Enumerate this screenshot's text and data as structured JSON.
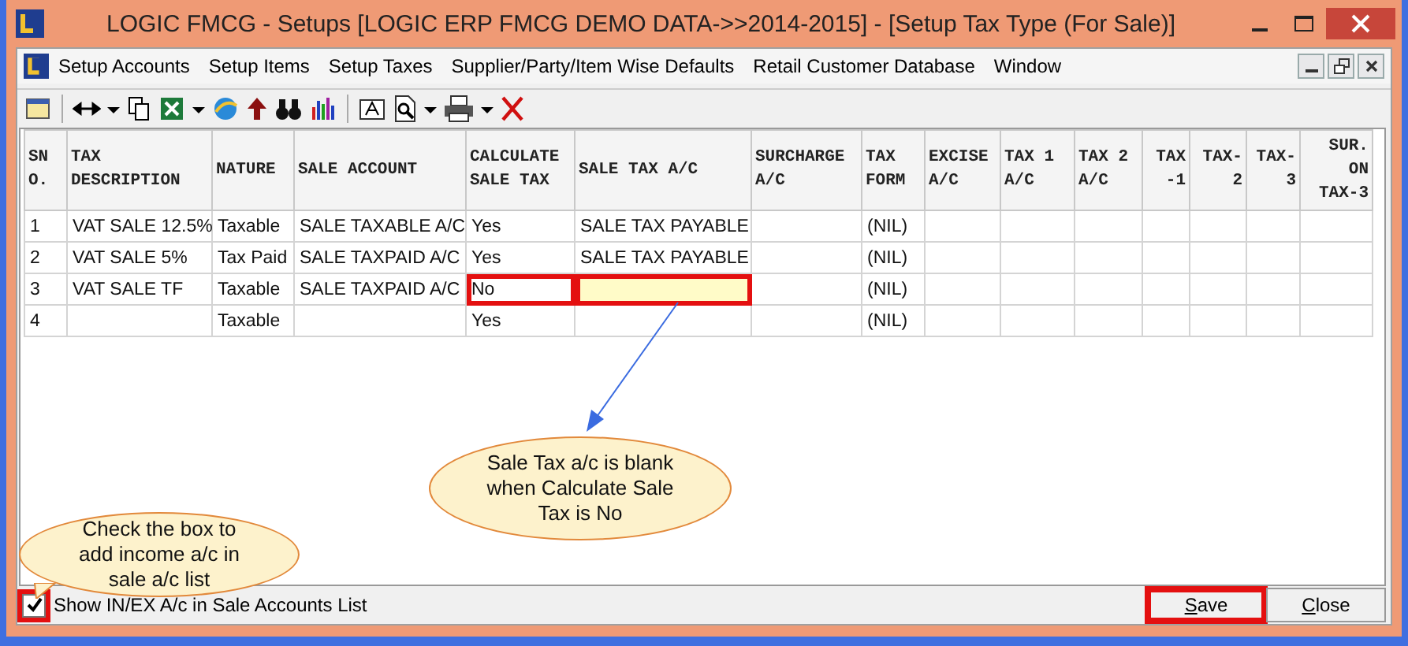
{
  "window": {
    "title": "LOGIC FMCG - Setups  [LOGIC ERP FMCG DEMO DATA->>2014-2015] - [Setup Tax Type (For Sale)]"
  },
  "menu": [
    "Setup Accounts",
    "Setup Items",
    "Setup Taxes",
    "Supplier/Party/Item Wise Defaults",
    "Retail Customer Database",
    "Window"
  ],
  "table": {
    "columns": [
      "SN O.",
      "TAX DESCRIPTION",
      "NATURE",
      "SALE ACCOUNT",
      "CALCULATE SALE TAX",
      "SALE TAX A/C",
      "SURCHARGE A/C",
      "TAX FORM",
      "EXCISE A/C",
      "TAX 1 A/C",
      "TAX 2 A/C",
      "TAX -1",
      "TAX- 2",
      "TAX- 3",
      "SUR. ON TAX-3"
    ],
    "rows": [
      {
        "cells": [
          {
            "text": "1",
            "marked": false,
            "focused": false
          },
          {
            "text": "VAT SALE 12.5%",
            "marked": false,
            "focused": false
          },
          {
            "text": "Taxable",
            "marked": false,
            "focused": false
          },
          {
            "text": "SALE TAXABLE A/C",
            "marked": false,
            "focused": false
          },
          {
            "text": "Yes",
            "marked": false,
            "focused": false
          },
          {
            "text": "SALE TAX PAYABLE",
            "marked": false,
            "focused": false
          },
          {
            "marked": false,
            "focused": false
          },
          {
            "text": "(NIL)",
            "marked": false,
            "focused": false
          },
          {
            "marked": false,
            "focused": false
          },
          {
            "marked": false,
            "focused": false
          },
          {
            "marked": false,
            "focused": false
          },
          {
            "marked": false,
            "focused": false
          },
          {
            "marked": false,
            "focused": false
          },
          {
            "marked": false,
            "focused": false
          },
          {
            "marked": false,
            "focused": false
          }
        ]
      },
      {
        "cells": [
          {
            "text": "2",
            "marked": false,
            "focused": false
          },
          {
            "text": "VAT SALE 5%",
            "marked": false,
            "focused": false
          },
          {
            "text": "Tax Paid",
            "marked": false,
            "focused": false
          },
          {
            "text": "SALE TAXPAID A/C",
            "marked": false,
            "focused": false
          },
          {
            "text": "Yes",
            "marked": false,
            "focused": false
          },
          {
            "text": "SALE TAX PAYABLE",
            "marked": false,
            "focused": false
          },
          {
            "marked": false,
            "focused": false
          },
          {
            "text": "(NIL)",
            "marked": false,
            "focused": false
          },
          {
            "marked": false,
            "focused": false
          },
          {
            "marked": false,
            "focused": false
          },
          {
            "marked": false,
            "focused": false
          },
          {
            "marked": false,
            "focused": false
          },
          {
            "marked": false,
            "focused": false
          },
          {
            "marked": false,
            "focused": false
          },
          {
            "marked": false,
            "focused": false
          }
        ]
      },
      {
        "cells": [
          {
            "text": "3",
            "marked": false,
            "focused": false
          },
          {
            "text": "VAT SALE TF",
            "marked": false,
            "focused": false
          },
          {
            "text": "Taxable",
            "marked": false,
            "focused": false
          },
          {
            "text": "SALE TAXPAID A/C",
            "marked": false,
            "focused": false
          },
          {
            "text": "No",
            "marked": true,
            "focused": false
          },
          {
            "marked": true,
            "focused": true
          },
          {
            "marked": false,
            "focused": false
          },
          {
            "text": "(NIL)",
            "marked": false,
            "focused": false
          },
          {
            "marked": false,
            "focused": false
          },
          {
            "marked": false,
            "focused": false
          },
          {
            "marked": false,
            "focused": false
          },
          {
            "marked": false,
            "focused": false
          },
          {
            "marked": false,
            "focused": false
          },
          {
            "marked": false,
            "focused": false
          },
          {
            "marked": false,
            "focused": false
          }
        ]
      },
      {
        "cells": [
          {
            "text": "4",
            "marked": false,
            "focused": false
          },
          {
            "marked": false,
            "focused": false
          },
          {
            "text": "Taxable",
            "marked": false,
            "focused": false
          },
          {
            "marked": false,
            "focused": false
          },
          {
            "text": "Yes",
            "marked": false,
            "focused": false
          },
          {
            "marked": false,
            "focused": false
          },
          {
            "marked": false,
            "focused": false
          },
          {
            "text": "(NIL)",
            "marked": false,
            "focused": false
          },
          {
            "marked": false,
            "focused": false
          },
          {
            "marked": false,
            "focused": false
          },
          {
            "marked": false,
            "focused": false
          },
          {
            "marked": false,
            "focused": false
          },
          {
            "marked": false,
            "focused": false
          },
          {
            "marked": false,
            "focused": false
          },
          {
            "marked": false,
            "focused": false
          }
        ]
      }
    ]
  },
  "callouts": [
    {
      "text": "Sale Tax a/c is blank when Calculate Sale Tax is No"
    },
    {
      "text": "Check the box to add income a/c in sale a/c list"
    }
  ],
  "footer": {
    "checkbox": {
      "label": "Show IN/EX A/c in Sale Accounts List",
      "checked": true,
      "marked": true
    },
    "buttons": [
      {
        "label": "Save",
        "marked": true
      },
      {
        "label": "Close",
        "marked": false
      }
    ]
  }
}
